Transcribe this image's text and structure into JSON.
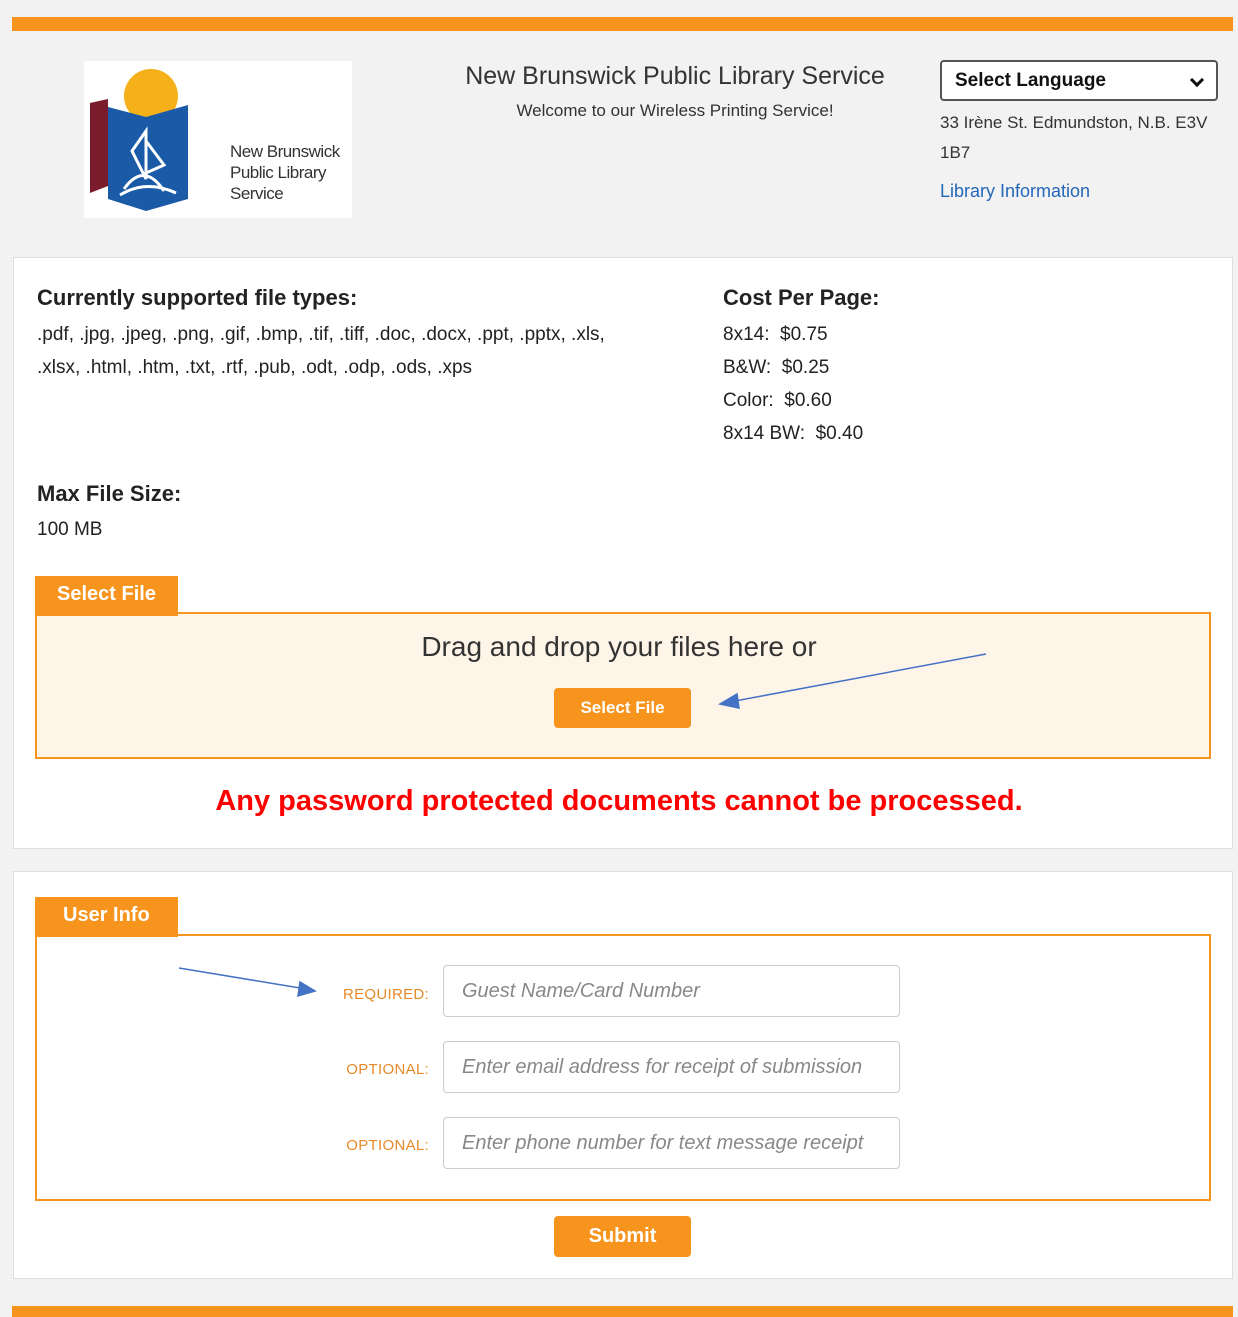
{
  "header": {
    "logo_lines": [
      "New Brunswick",
      "Public Library",
      "Service"
    ],
    "title": "New Brunswick Public Library Service",
    "subtitle": "Welcome to our Wireless Printing Service!",
    "language_select": "Select Language",
    "address": "33 Irène St. Edmundston, N.B. E3V 1B7",
    "library_info_link": "Library Information"
  },
  "info": {
    "file_types_heading": "Currently supported file types:",
    "file_types_line1": ".pdf, .jpg, .jpeg, .png, .gif, .bmp, .tif, .tiff, .doc, .docx, .ppt, .pptx, .xls,",
    "file_types_line2": ".xlsx, .html, .htm, .txt, .rtf, .pub, .odt, .odp, .ods, .xps",
    "cost_heading": "Cost Per Page:",
    "costs": [
      {
        "label": "8x14:",
        "price": "$0.75"
      },
      {
        "label": "B&W:",
        "price": "$0.25"
      },
      {
        "label": "Color:",
        "price": "$0.60"
      },
      {
        "label": "8x14 BW:",
        "price": "$0.40"
      }
    ],
    "max_size_heading": "Max File Size:",
    "max_size_value": "100 MB"
  },
  "upload": {
    "tab_label": "Select File",
    "drop_text": "Drag and drop your files here or",
    "button_label": "Select File",
    "warning": "Any password protected documents cannot be processed."
  },
  "user_info": {
    "tab_label": "User Info",
    "fields": [
      {
        "label": "REQUIRED:",
        "placeholder": "Guest Name/Card Number"
      },
      {
        "label": "OPTIONAL:",
        "placeholder": "Enter email address for receipt of submission"
      },
      {
        "label": "OPTIONAL:",
        "placeholder": "Enter phone number for text message receipt"
      }
    ],
    "submit_label": "Submit"
  },
  "colors": {
    "accent": "#f7941d",
    "warning": "#ff0000",
    "link": "#2466b8",
    "annotation_arrow": "#4472c4"
  }
}
